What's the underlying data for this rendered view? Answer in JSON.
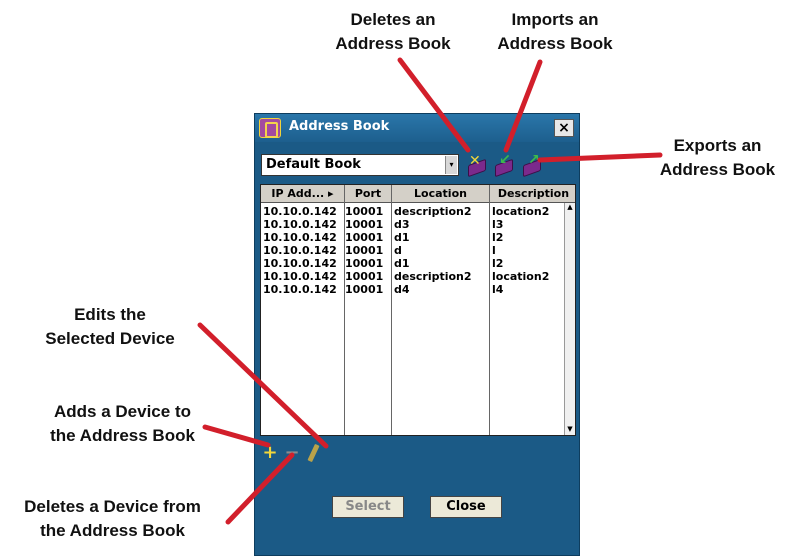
{
  "callouts": {
    "delete_book": [
      "Deletes an",
      "Address Book"
    ],
    "import_book": [
      "Imports an",
      "Address Book"
    ],
    "export_book": [
      "Exports an",
      "Address Book"
    ],
    "edit_device": [
      "Edits the",
      "Selected Device"
    ],
    "add_device": [
      "Adds a Device to",
      "the Address Book"
    ],
    "delete_device": [
      "Deletes a Device from",
      "the Address Book"
    ]
  },
  "window": {
    "title": "Address Book",
    "close_glyph": "×",
    "book_select": {
      "value": "Default Book",
      "arrow": "▾"
    },
    "toolbar_icons": [
      "delete-book-icon",
      "import-book-icon",
      "export-book-icon"
    ]
  },
  "table": {
    "columns": [
      "IP Add... ▸",
      "Port",
      "Location",
      "Description"
    ],
    "rows": [
      [
        "10.10.0.142",
        "10001",
        "description2",
        "location2"
      ],
      [
        "10.10.0.142",
        "10001",
        "d3",
        "l3"
      ],
      [
        "10.10.0.142",
        "10001",
        "d1",
        "l2"
      ],
      [
        "10.10.0.142",
        "10001",
        "d",
        "l"
      ],
      [
        "10.10.0.142",
        "10001",
        "d1",
        "l2"
      ],
      [
        "10.10.0.142",
        "10001",
        "description2",
        "location2"
      ],
      [
        "10.10.0.142",
        "10001",
        "d4",
        "l4"
      ]
    ]
  },
  "device_actions": {
    "add": "+",
    "delete": "−"
  },
  "buttons": {
    "select": "Select",
    "close": "Close"
  },
  "colors": {
    "window_bg": "#1b5a86",
    "arrow": "#d21f2b",
    "accent_yellow": "#f2d73a"
  }
}
